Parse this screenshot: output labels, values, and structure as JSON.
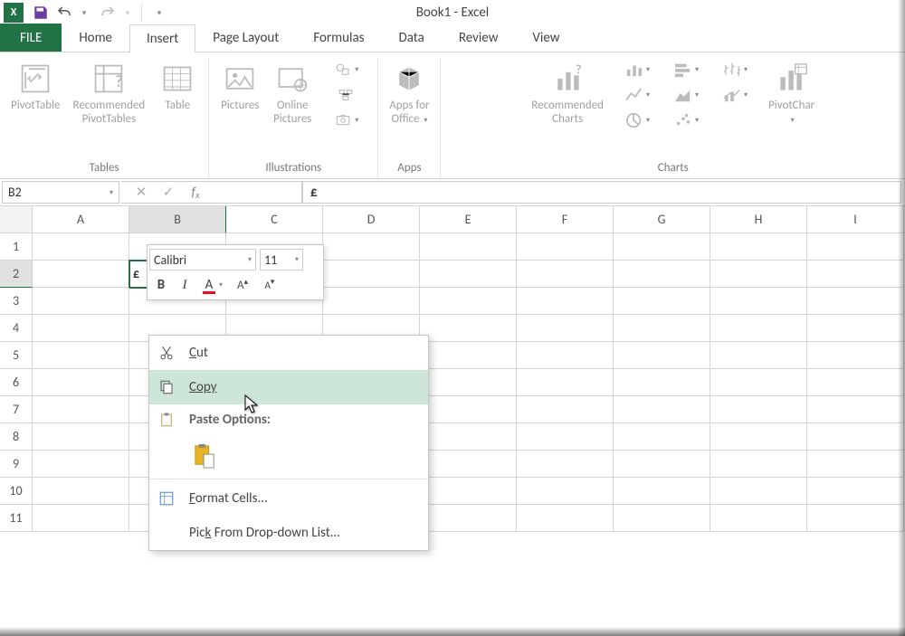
{
  "title": "Book1 - Excel",
  "qat": {
    "excel_label": "X"
  },
  "tabs": {
    "file": "FILE",
    "list": [
      "Home",
      "Insert",
      "Page Layout",
      "Formulas",
      "Data",
      "Review",
      "View"
    ],
    "active": "Insert"
  },
  "ribbon": {
    "tables": {
      "label": "Tables",
      "pivot": "PivotTable",
      "recommended_l1": "Recommended",
      "recommended_l2": "PivotTables",
      "table": "Table"
    },
    "illustrations": {
      "label": "Illustrations",
      "pictures": "Pictures",
      "online_l1": "Online",
      "online_l2": "Pictures"
    },
    "apps": {
      "label": "Apps",
      "apps_l1": "Apps for",
      "apps_l2": "Office"
    },
    "charts": {
      "label": "Charts",
      "recommended_l1": "Recommended",
      "recommended_l2": "Charts",
      "pivotchart": "PivotChar"
    }
  },
  "formula_bar": {
    "namebox": "B2",
    "fx": "fx",
    "value": "£"
  },
  "grid": {
    "col_headers": [
      "A",
      "B",
      "C",
      "D",
      "E",
      "F",
      "G",
      "H",
      "I"
    ],
    "row_headers": [
      "1",
      "2",
      "3",
      "4",
      "5",
      "6",
      "7",
      "8",
      "9",
      "10",
      "11"
    ],
    "active_cell": "B2",
    "active_cell_value": "£"
  },
  "mini_toolbar": {
    "font": "Calibri",
    "size": "11",
    "bold": "B",
    "italic": "I",
    "fontcolor": "A",
    "grow": "A",
    "shrink": "A"
  },
  "context_menu": {
    "cut": "Cut",
    "copy": "Copy",
    "paste_header": "Paste Options:",
    "format_cells": "Format Cells...",
    "pick_list": "Pick From Drop-down List..."
  }
}
